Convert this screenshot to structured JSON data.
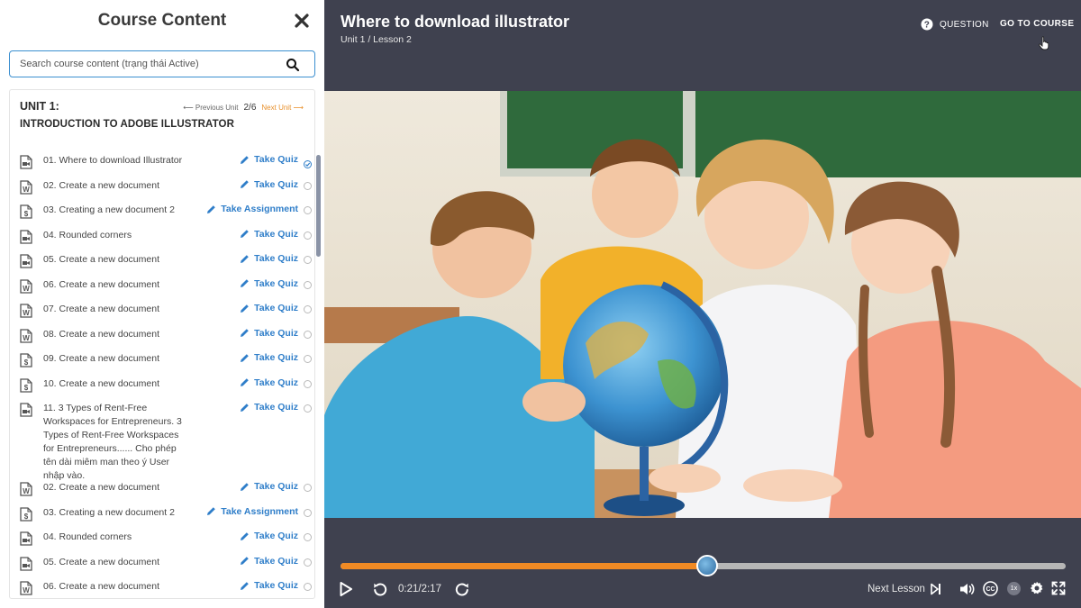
{
  "sidebar": {
    "title": "Course Content",
    "close_icon": "close-icon",
    "search": {
      "placeholder": "Search course content (trạng thái Active)"
    },
    "unit": {
      "label": "UNIT 1:",
      "title": "INTRODUCTION TO ADOBE ILLUSTRATOR",
      "prev_label": "⟵ Previous Unit",
      "count": "2/6",
      "next_label": "Next Unit ⟶"
    },
    "lessons": [
      {
        "title": "01. Where to download Illustrator",
        "icon": "video-icon",
        "action": "Take Quiz",
        "done": true
      },
      {
        "title": "02. Create a new document",
        "icon": "word-doc-icon",
        "action": "Take Quiz",
        "done": false
      },
      {
        "title": "03. Creating a new document 2",
        "icon": "script-doc-icon",
        "action": "Take Assignment",
        "done": false
      },
      {
        "title": "04. Rounded corners",
        "icon": "video-icon",
        "action": "Take Quiz",
        "done": false
      },
      {
        "title": "05. Create a new document",
        "icon": "video-icon",
        "action": "Take Quiz",
        "done": false
      },
      {
        "title": "06. Create a new document",
        "icon": "word-doc-icon",
        "action": "Take Quiz",
        "done": false
      },
      {
        "title": "07. Create a new document",
        "icon": "word-doc-icon",
        "action": "Take Quiz",
        "done": false
      },
      {
        "title": "08. Create a new document",
        "icon": "word-doc-icon",
        "action": "Take Quiz",
        "done": false
      },
      {
        "title": "09. Create a new document",
        "icon": "script-doc-icon",
        "action": "Take Quiz",
        "done": false
      },
      {
        "title": "10. Create a new document",
        "icon": "script-doc-icon",
        "action": "Take Quiz",
        "done": false
      },
      {
        "title": "11. 3 Types of Rent-Free Workspaces for Entrepreneurs. 3 Types of Rent-Free Workspaces for Entrepreneurs...... Cho phép tên dài miêm man theo ý User nhập vào.",
        "icon": "video-icon",
        "action": "Take Quiz",
        "done": false
      },
      {
        "title": "02. Create a new document",
        "icon": "word-doc-icon",
        "action": "Take Quiz",
        "done": false
      },
      {
        "title": "03. Creating a new document 2",
        "icon": "script-doc-icon",
        "action": "Take Assignment",
        "done": false
      },
      {
        "title": "04. Rounded corners",
        "icon": "video-icon",
        "action": "Take Quiz",
        "done": false
      },
      {
        "title": "05. Create a new document",
        "icon": "video-icon",
        "action": "Take Quiz",
        "done": false
      },
      {
        "title": "06. Create a new document",
        "icon": "word-doc-icon",
        "action": "Take Quiz",
        "done": false
      }
    ]
  },
  "player": {
    "title": "Where to download illustrator",
    "breadcrumb": "Unit 1 / Lesson 2",
    "question_label": "QUESTION",
    "goto_label": "GO TO COURSE",
    "time": "0:21/2:17",
    "progress": 0.505,
    "next_lesson_label": "Next Lesson",
    "speed": "1x"
  },
  "colors": {
    "accent_blue": "#2f7ec9",
    "accent_orange": "#f08a24",
    "player_bg": "#3f414f"
  }
}
